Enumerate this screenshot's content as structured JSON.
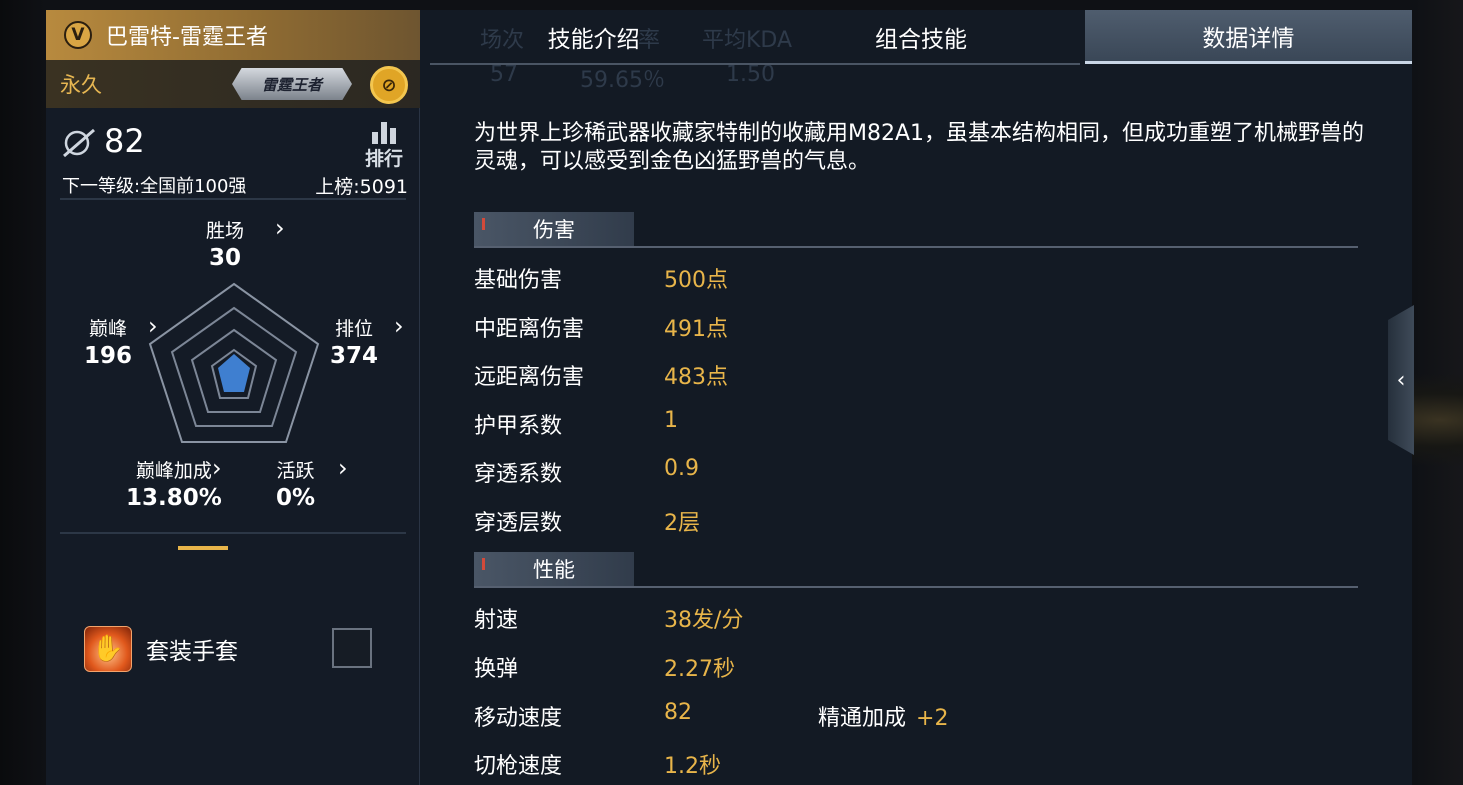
{
  "weapon": {
    "title": "巴雷特-雷霆王者",
    "badge": "V",
    "permanence": "永久",
    "rank_plate": "雷霆王者",
    "coin_icon": "gold-coin-icon"
  },
  "stats": {
    "level": "82",
    "ranking_label": "排行",
    "next_level": "下一等级:全国前100强",
    "leaderboard": "上榜:5091",
    "wins_label": "胜场",
    "wins": "30",
    "peak_label": "巅峰",
    "peak": "196",
    "ranked_label": "排位",
    "ranked": "374",
    "peak_bonus_label": "巅峰加成",
    "peak_bonus": "13.80%",
    "activity_label": "活跃",
    "activity": "0%"
  },
  "suit": {
    "label": "套装手套",
    "checked": false
  },
  "tabs": [
    {
      "label": "技能介绍",
      "active": false
    },
    {
      "label": "组合技能",
      "active": false
    },
    {
      "label": "数据详情",
      "active": true
    }
  ],
  "ghost_header": {
    "matches": "场次",
    "winrate": "率",
    "kda": "平均KDA",
    "matches_val": "57",
    "winrate_val": "59.65％",
    "kda_val": "1.50"
  },
  "description": "为世界上珍稀武器收藏家特制的收藏用M82A1，虽基本结构相同，但成功重塑了机械野兽的灵魂，可以感受到金色凶猛野兽的气息。",
  "sections": {
    "damage": {
      "title": "伤害",
      "rows": [
        {
          "label": "基础伤害",
          "value": "500点"
        },
        {
          "label": "中距离伤害",
          "value": "491点"
        },
        {
          "label": "远距离伤害",
          "value": "483点"
        },
        {
          "label": "护甲系数",
          "value": "1"
        },
        {
          "label": "穿透系数",
          "value": "0.9"
        },
        {
          "label": "穿透层数",
          "value": "2层"
        }
      ]
    },
    "performance": {
      "title": "性能",
      "rows": [
        {
          "label": "射速",
          "value": "38发/分"
        },
        {
          "label": "换弹",
          "value": "2.27秒"
        },
        {
          "label": "移动速度",
          "value": "82",
          "extra_label": "精通加成",
          "extra_value": "+2"
        },
        {
          "label": "切枪速度",
          "value": "1.2秒"
        }
      ]
    }
  },
  "colors": {
    "accent_gold": "#e8b54a",
    "title_bar": "#b88a3e",
    "active_tab": "#4f5d6e"
  }
}
